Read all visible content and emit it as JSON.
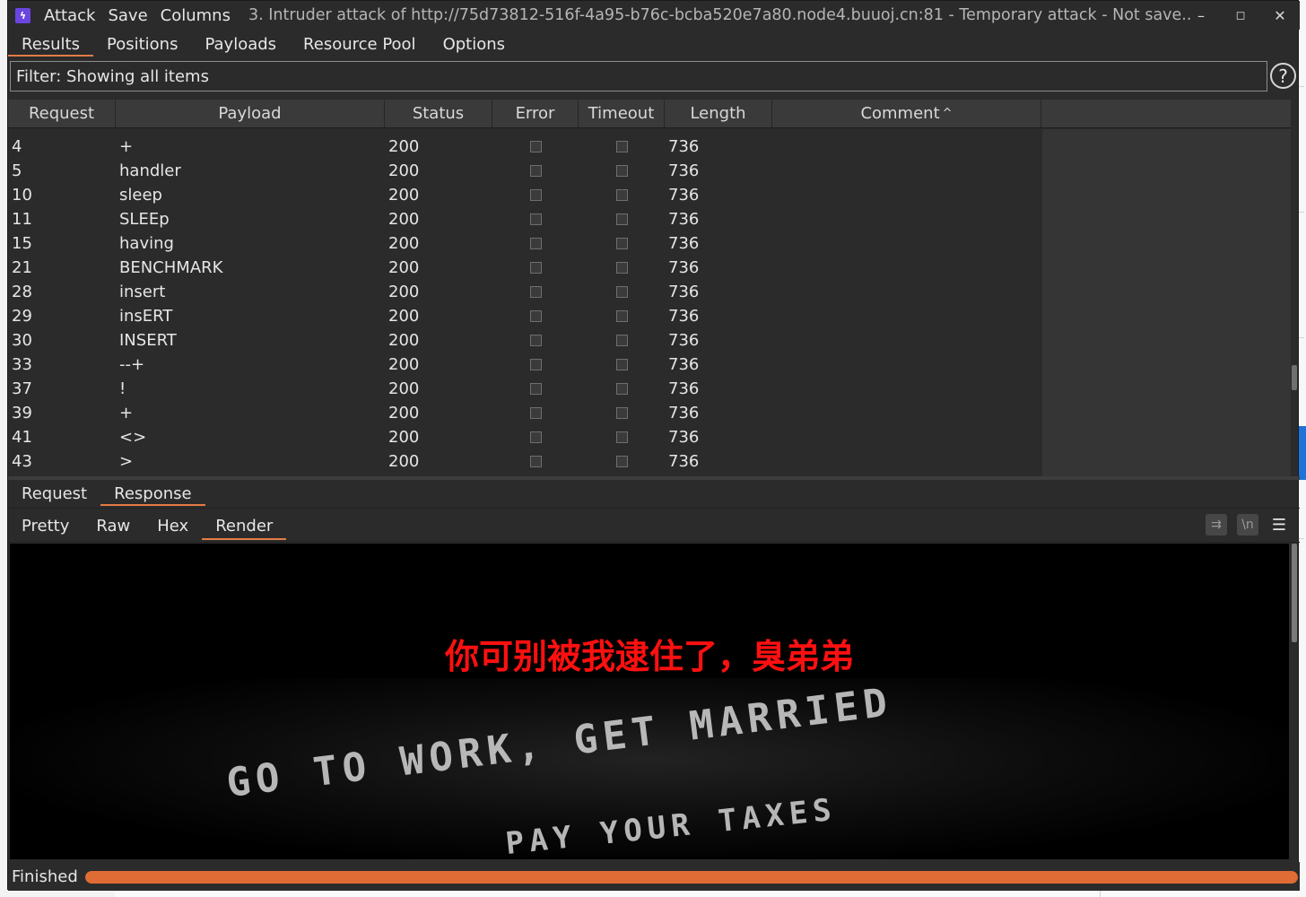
{
  "titlebar": {
    "menu": [
      "Attack",
      "Save",
      "Columns"
    ],
    "title": "3. Intruder attack of http://75d73812-516f-4a95-b76c-bcba520e7a80.node4.buuoj.cn:81 - Temporary attack - Not save...",
    "controls": [
      "–",
      "◻",
      "✕"
    ]
  },
  "main_tabs": [
    "Results",
    "Positions",
    "Payloads",
    "Resource Pool",
    "Options"
  ],
  "active_main_tab": "Results",
  "filter": {
    "text": "Filter: Showing all items",
    "help": "?"
  },
  "table": {
    "columns": [
      "Request",
      "Payload",
      "Status",
      "Error",
      "Timeout",
      "Length",
      "Comment"
    ],
    "sort_indicator": "^",
    "rows": [
      {
        "request": "4",
        "payload": "+",
        "status": "200",
        "length": "736"
      },
      {
        "request": "5",
        "payload": "handler",
        "status": "200",
        "length": "736"
      },
      {
        "request": "10",
        "payload": "sleep",
        "status": "200",
        "length": "736"
      },
      {
        "request": "11",
        "payload": "SLEEp",
        "status": "200",
        "length": "736"
      },
      {
        "request": "15",
        "payload": "having",
        "status": "200",
        "length": "736"
      },
      {
        "request": "21",
        "payload": "BENCHMARK",
        "status": "200",
        "length": "736"
      },
      {
        "request": "28",
        "payload": "insert",
        "status": "200",
        "length": "736"
      },
      {
        "request": "29",
        "payload": "insERT",
        "status": "200",
        "length": "736"
      },
      {
        "request": "30",
        "payload": "INSERT",
        "status": "200",
        "length": "736"
      },
      {
        "request": "33",
        "payload": "--+",
        "status": "200",
        "length": "736"
      },
      {
        "request": "37",
        "payload": "!",
        "status": "200",
        "length": "736"
      },
      {
        "request": "39",
        "payload": "+",
        "status": "200",
        "length": "736"
      },
      {
        "request": "41",
        "payload": "<>",
        "status": "200",
        "length": "736"
      },
      {
        "request": "43",
        "payload": ">",
        "status": "200",
        "length": "736"
      }
    ]
  },
  "rr_tabs": [
    "Request",
    "Response"
  ],
  "active_rr_tab": "Response",
  "view_tabs": [
    "Pretty",
    "Raw",
    "Hex",
    "Render"
  ],
  "active_view_tab": "Render",
  "tools": {
    "wrap": "⇉",
    "newline": "\\n",
    "menu": "☰"
  },
  "render": {
    "headline": "你可别被我逮住了，臭弟弟",
    "stamp_line1": "GO TO WORK, GET MARRIED",
    "stamp_line2": "PAY YOUR TAXES"
  },
  "status": {
    "text": "Finished",
    "progress": 1.0
  },
  "colors": {
    "accent": "#e37c45",
    "progress": "#e06c35",
    "headline": "#ff1010",
    "app_icon": "#6a45e0"
  }
}
